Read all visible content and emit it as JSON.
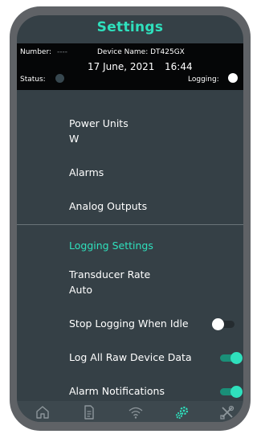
{
  "header": {
    "title": "Settings",
    "number_label": "Number:",
    "number_value": "----",
    "device_name_label": "Device Name: DT425GX",
    "date": "17 June, 2021",
    "time": "16:44",
    "status_label": "Status:",
    "logging_label": "Logging:"
  },
  "settings": {
    "power_units_label": "Power Units",
    "power_units_value": "W",
    "alarms_label": "Alarms",
    "analog_outputs_label": "Analog Outputs"
  },
  "logging": {
    "section_title": "Logging Settings",
    "transducer_rate_label": "Transducer Rate",
    "transducer_rate_value": "Auto",
    "stop_logging_label": "Stop Logging When Idle",
    "stop_logging_on": false,
    "log_raw_label": "Log All Raw Device Data",
    "log_raw_on": true,
    "alarm_notifications_label": "Alarm Notifications",
    "alarm_notifications_on": true
  },
  "nav": {
    "items": [
      "home-icon",
      "document-icon",
      "wifi-icon",
      "settings-gear-icon",
      "tools-icon"
    ],
    "active": "settings-gear-icon"
  },
  "colors": {
    "accent": "#2fe0bd",
    "background": "#354046",
    "header_band": "#050607",
    "frame": "#5f6266"
  }
}
